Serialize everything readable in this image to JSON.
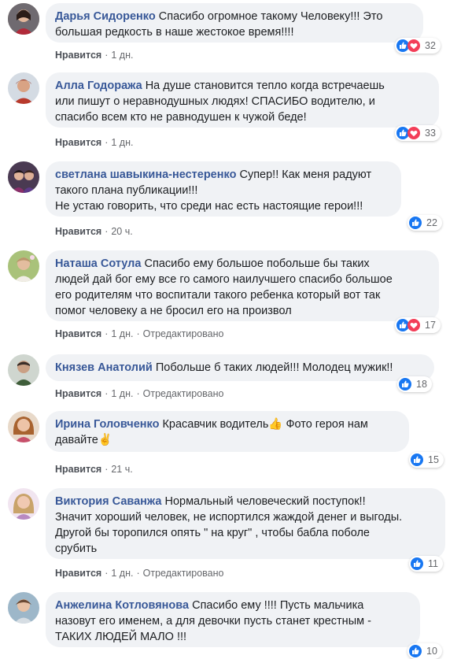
{
  "comments": [
    {
      "author": "Дарья Сидоренко",
      "text": "Спасибо огромное такому Человеку!!! Это\nбольшая редкость в наше жестокое время!!!!",
      "like_label": "Нравится",
      "time": "1 дн.",
      "edited": "",
      "reactions": [
        "like",
        "love"
      ],
      "count": "32"
    },
    {
      "author": "Алла Годоража",
      "text": "На душе становится тепло когда встречаешь\nили пишут о неравнодушных людях! СПАСИБО водителю, и\nспасибо всем кто не равнодушен к чужой беде!",
      "like_label": "Нравится",
      "time": "1 дн.",
      "edited": "",
      "reactions": [
        "like",
        "love"
      ],
      "count": "33"
    },
    {
      "author": "светлана шавыкина-нестеренко",
      "text": "Супер!! Как меня радуют\nтакого плана публикации!!!\nНе устаю говорить, что среди нас есть настоящие герои!!!",
      "like_label": "Нравится",
      "time": "20 ч.",
      "edited": "",
      "reactions": [
        "like"
      ],
      "count": "22"
    },
    {
      "author": "Наташа Сотула",
      "text": "Спасибо ему большое побольше бы таких\nлюдей дай бог ему все го самого наилучшего спасибо большое\nего родителям что воспитали такого ребенка который вот так\nпомог человеку а не бросил его на произвол",
      "like_label": "Нравится",
      "time": "1 дн.",
      "edited": "Отредактировано",
      "reactions": [
        "like",
        "love"
      ],
      "count": "17"
    },
    {
      "author": "Князев Анатолий",
      "text": "Побольше б таких людей!!! Молодец мужик!!",
      "like_label": "Нравится",
      "time": "1 дн.",
      "edited": "Отредактировано",
      "reactions": [
        "like"
      ],
      "count": "18"
    },
    {
      "author": "Ирина Головченко",
      "text": "Красавчик водитель👍 Фото героя нам\nдавайте✌",
      "like_label": "Нравится",
      "time": "21 ч.",
      "edited": "",
      "reactions": [
        "like"
      ],
      "count": "15"
    },
    {
      "author": "Виктория Саванжа",
      "text": "Нормальный человеческий поступок!!\nЗначит хороший человек, не испортился жаждой денег и выгоды.\nДругой бы торопился опять \" на круг\" , чтобы бабла поболе\nсрубить",
      "like_label": "Нравится",
      "time": "1 дн.",
      "edited": "Отредактировано",
      "reactions": [
        "like"
      ],
      "count": "11"
    },
    {
      "author": "Анжелина Котловянова",
      "text": "Спасибо ему !!!! Пусть мальчика\nназовут его именем, а для девочки пусть станет крестным -\nТАКИХ ЛЮДЕЙ МАЛО !!!",
      "like_label": "",
      "time": "",
      "edited": "",
      "reactions": [
        "like"
      ],
      "count": "10"
    }
  ],
  "colors": {
    "bubble": "#f0f2f5",
    "author": "#385898",
    "like_blue": "#1877f2",
    "love_red": "#f33e58"
  }
}
